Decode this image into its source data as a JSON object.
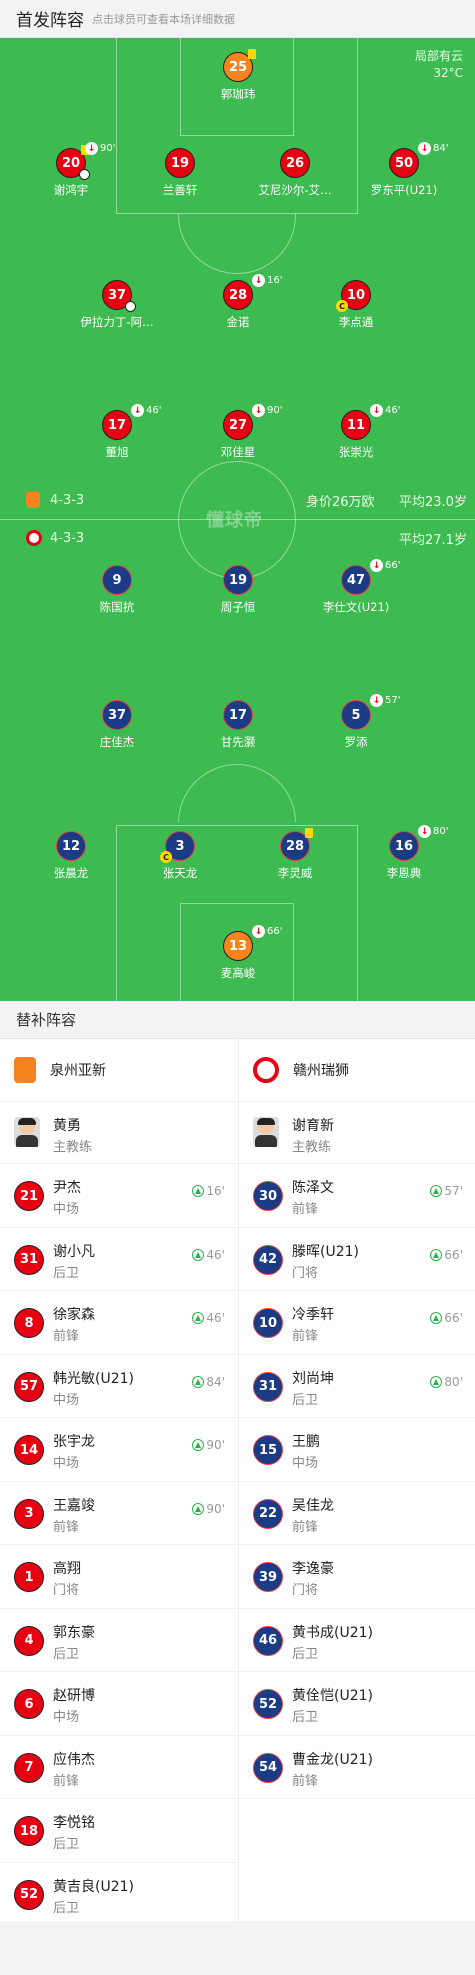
{
  "header": {
    "title": "首发阵容",
    "subtitle": "点击球员可查看本场详细数据"
  },
  "weather": {
    "condition": "局部有云",
    "temp": "32°C"
  },
  "home": {
    "formation": "4-3-3",
    "value": "身价26万欧",
    "age": "平均23.0岁",
    "players": [
      {
        "num": "25",
        "name": "郭珈玮",
        "kit": "orange",
        "ycard": true
      },
      {
        "num": "20",
        "name": "谢鸿宇",
        "kit": "red",
        "sub": "90'",
        "ycard": true,
        "goal": true
      },
      {
        "num": "19",
        "name": "兰善轩",
        "kit": "red"
      },
      {
        "num": "26",
        "name": "艾尼沙尔-艾…",
        "kit": "red"
      },
      {
        "num": "50",
        "name": "罗东平(U21)",
        "kit": "red",
        "sub": "84'"
      },
      {
        "num": "37",
        "name": "伊拉力丁-阿…",
        "kit": "red",
        "goal": true
      },
      {
        "num": "28",
        "name": "金诺",
        "kit": "red",
        "sub": "16'"
      },
      {
        "num": "10",
        "name": "李点通",
        "kit": "red",
        "cap": true
      },
      {
        "num": "17",
        "name": "董旭",
        "kit": "red",
        "sub": "46'"
      },
      {
        "num": "27",
        "name": "邓佳星",
        "kit": "red",
        "sub": "90'"
      },
      {
        "num": "11",
        "name": "张崇光",
        "kit": "red",
        "sub": "46'"
      }
    ]
  },
  "away": {
    "formation": "4-3-3",
    "age": "平均27.1岁",
    "players": [
      {
        "num": "9",
        "name": "陈国抗",
        "kit": "blue"
      },
      {
        "num": "19",
        "name": "周子恒",
        "kit": "blue"
      },
      {
        "num": "47",
        "name": "李仕文(U21)",
        "kit": "blue",
        "sub": "66'"
      },
      {
        "num": "37",
        "name": "庄佳杰",
        "kit": "blue"
      },
      {
        "num": "17",
        "name": "甘先灏",
        "kit": "blue"
      },
      {
        "num": "5",
        "name": "罗添",
        "kit": "blue",
        "sub": "57'"
      },
      {
        "num": "12",
        "name": "张晨龙",
        "kit": "blue"
      },
      {
        "num": "3",
        "name": "张天龙",
        "kit": "blue",
        "cap": true
      },
      {
        "num": "28",
        "name": "李灵威",
        "kit": "blue",
        "ycard": true
      },
      {
        "num": "16",
        "name": "李恩典",
        "kit": "blue",
        "sub": "80'"
      },
      {
        "num": "13",
        "name": "麦高峻",
        "kit": "orange",
        "sub": "66'"
      }
    ]
  },
  "watermark": "懂球帝",
  "subs_header": "替补阵容",
  "bench": {
    "home": {
      "team": "泉州亚新",
      "coach": {
        "name": "黄勇",
        "role": "主教练"
      },
      "players": [
        {
          "num": "21",
          "name": "尹杰",
          "pos": "中场",
          "time": "16'"
        },
        {
          "num": "31",
          "name": "谢小凡",
          "pos": "后卫",
          "time": "46'"
        },
        {
          "num": "8",
          "name": "徐家森",
          "pos": "前锋",
          "time": "46'"
        },
        {
          "num": "57",
          "name": "韩光敏(U21)",
          "pos": "中场",
          "time": "84'"
        },
        {
          "num": "14",
          "name": "张宇龙",
          "pos": "中场",
          "time": "90'"
        },
        {
          "num": "3",
          "name": "王嘉竣",
          "pos": "前锋",
          "time": "90'"
        },
        {
          "num": "1",
          "name": "高翔",
          "pos": "门将",
          "time": ""
        },
        {
          "num": "4",
          "name": "郭东豪",
          "pos": "后卫",
          "time": ""
        },
        {
          "num": "6",
          "name": "赵研博",
          "pos": "中场",
          "time": ""
        },
        {
          "num": "7",
          "name": "应伟杰",
          "pos": "前锋",
          "time": ""
        },
        {
          "num": "18",
          "name": "李悦铭",
          "pos": "后卫",
          "time": ""
        },
        {
          "num": "52",
          "name": "黄吉良(U21)",
          "pos": "后卫",
          "time": ""
        }
      ]
    },
    "away": {
      "team": "赣州瑞狮",
      "coach": {
        "name": "谢育新",
        "role": "主教练"
      },
      "players": [
        {
          "num": "30",
          "name": "陈泽文",
          "pos": "前锋",
          "time": "57'"
        },
        {
          "num": "42",
          "name": "滕晖(U21)",
          "pos": "门将",
          "time": "66'"
        },
        {
          "num": "10",
          "name": "冷季轩",
          "pos": "前锋",
          "time": "66'"
        },
        {
          "num": "31",
          "name": "刘尚坤",
          "pos": "后卫",
          "time": "80'"
        },
        {
          "num": "15",
          "name": "王鹏",
          "pos": "中场",
          "time": ""
        },
        {
          "num": "22",
          "name": "吴佳龙",
          "pos": "前锋",
          "time": ""
        },
        {
          "num": "39",
          "name": "李逸豪",
          "pos": "门将",
          "time": ""
        },
        {
          "num": "46",
          "name": "黄书成(U21)",
          "pos": "后卫",
          "time": ""
        },
        {
          "num": "52",
          "name": "黄佺恺(U21)",
          "pos": "后卫",
          "time": ""
        },
        {
          "num": "54",
          "name": "曹金龙(U21)",
          "pos": "前锋",
          "time": ""
        }
      ]
    }
  },
  "colors": {
    "pitch": "#3dbb50",
    "home_kit": "#e60012",
    "away_kit": "#1b3b85",
    "gk_kit": "#f5841f",
    "sub_in": "#2bb24c"
  }
}
